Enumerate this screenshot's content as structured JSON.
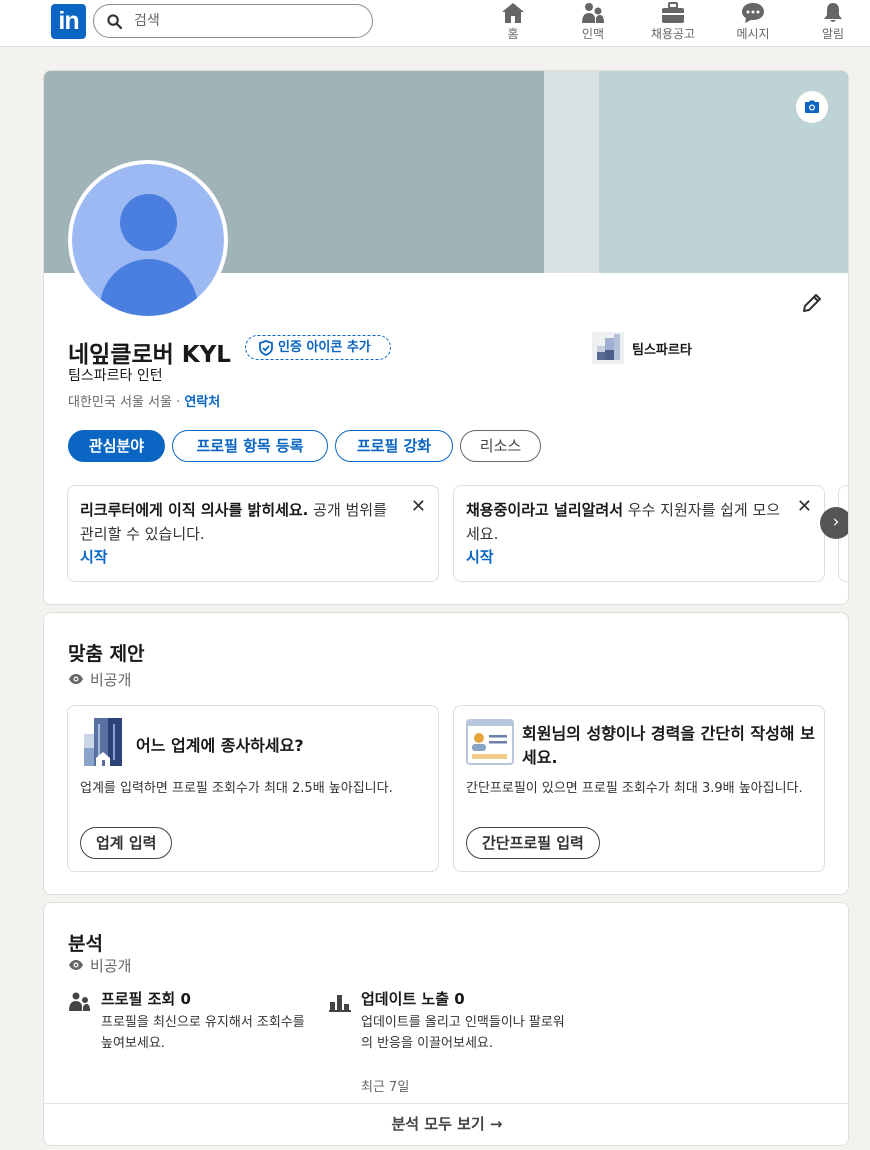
{
  "nav": {
    "logo": "in",
    "search_placeholder": "검색",
    "items": [
      {
        "label": "홈",
        "icon": "home-icon"
      },
      {
        "label": "인맥",
        "icon": "network-icon"
      },
      {
        "label": "채용공고",
        "icon": "briefcase-icon"
      },
      {
        "label": "메시지",
        "icon": "messaging-icon"
      },
      {
        "label": "알림",
        "icon": "bell-icon"
      }
    ]
  },
  "profile": {
    "name": "네잎클로버 KYL",
    "verify_label": "인증 아이콘 추가",
    "headline": "팀스파르타 인턴",
    "location": "대한민국 서울 서울 · ",
    "contact_link": "연락처",
    "company": "팀스파르타",
    "buttons": [
      "관심분야",
      "프로필 항목 등록",
      "프로필 강화",
      "리소스"
    ],
    "prompts": [
      {
        "bold": "리크루터에게 이직 의사를 밝히세요.",
        "text": " 공개 범위를 관리할 수 있습니다.",
        "action": "시작"
      },
      {
        "bold": "채용중이라고 널리알려서",
        "text": " 우수 지원자를 쉽게 모으세요.",
        "action": "시작"
      }
    ],
    "next_arrow": "›",
    "close_glyph": "✕"
  },
  "suggestions": {
    "title": "맞춤 제안",
    "visibility": "비공개",
    "cards": [
      {
        "title": "어느 업계에 종사하세요?",
        "desc": "업계를 입력하면 프로필 조회수가 최대 2.5배 높아집니다.",
        "button": "업계 입력"
      },
      {
        "title": "회원님의 성향이나 경력을 간단히 작성해 보세요.",
        "desc": "간단프로필이 있으면 프로필 조회수가 최대 3.9배 높아집니다.",
        "button": "간단프로필 입력"
      }
    ]
  },
  "analytics": {
    "title": "분석",
    "visibility": "비공개",
    "stats": [
      {
        "title": "프로필 조회 0",
        "desc": "프로필을 최신으로 유지해서 조회수를 높여보세요.",
        "meta": ""
      },
      {
        "title": "업데이트 노출 0",
        "desc": "업데이트를 올리고 인맥들이나 팔로워의 반응을 이끌어보세요.",
        "meta": "최근 7일"
      }
    ],
    "see_all": "분석 모두 보기 →"
  },
  "colors": {
    "brand": "#0a66c2",
    "background": "#f4f2ee"
  }
}
